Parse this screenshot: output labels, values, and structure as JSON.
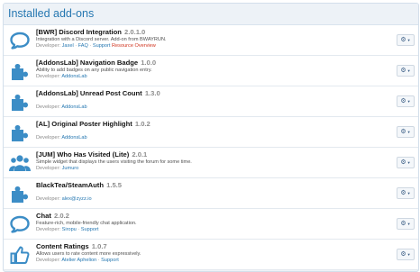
{
  "header": {
    "title": "Installed add-ons"
  },
  "addons": [
    {
      "icon": "speech-bubble-icon",
      "title": "[BWR] Discord Integration",
      "version": "2.0.1.0",
      "description": "Integration with a Discord server. Add-on from BWAYRUN.",
      "dev_prefix": "Developer:",
      "links": [
        "Jaxel",
        "FAQ",
        "Support"
      ],
      "resource": "Resource Overview"
    },
    {
      "icon": "puzzle-piece-icon",
      "title": "[AddonsLab] Navigation Badge",
      "version": "1.0.0",
      "description": "Ability to add badges on any public navigation entry.",
      "dev_prefix": "Developer:",
      "links": [
        "AddonsLab"
      ]
    },
    {
      "icon": "puzzle-piece-icon",
      "title": "[AddonsLab] Unread Post Count",
      "version": "1.3.0",
      "description": "",
      "dev_prefix": "Developer:",
      "links": [
        "AddonsLab"
      ]
    },
    {
      "icon": "puzzle-piece-icon",
      "title": "[AL] Original Poster Highlight",
      "version": "1.0.2",
      "description": "",
      "dev_prefix": "Developer:",
      "links": [
        "AddonsLab"
      ]
    },
    {
      "icon": "users-icon",
      "title": "[JUM] Who Has Visited (Lite)",
      "version": "2.0.1",
      "description": "Simple widget that displays the users visiting the forum for some time.",
      "dev_prefix": "Developer:",
      "links": [
        "Jumuro"
      ]
    },
    {
      "icon": "puzzle-piece-icon",
      "title": "BlackTea/SteamAuth",
      "version": "1.5.5",
      "description": "",
      "dev_prefix": "Developer:",
      "links": [
        "alex@zyzz.io"
      ]
    },
    {
      "icon": "speech-bubble-icon",
      "title": "Chat",
      "version": "2.0.2",
      "description": "Feature-rich, mobile-friendly chat application.",
      "dev_prefix": "Developer:",
      "links": [
        "Siropu",
        "Support"
      ]
    },
    {
      "icon": "thumbs-up-icon",
      "title": "Content Ratings",
      "version": "1.0.7",
      "description": "Allows users to rate content more expressively.",
      "dev_prefix": "Developer:",
      "links": [
        "Atelier Aphelion",
        "Support"
      ]
    }
  ],
  "colors": {
    "accent": "#2577b1",
    "resource": "#d0341f",
    "icon": "#3c8dc6"
  },
  "controls": {
    "menu_icon": "gear-icon",
    "caret_icon": "caret-down-icon"
  }
}
